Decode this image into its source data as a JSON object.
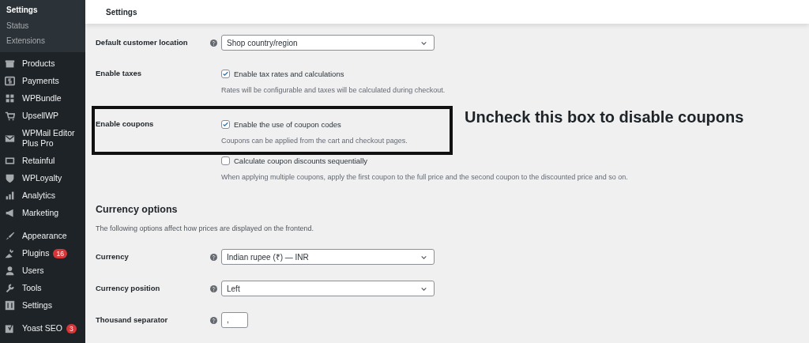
{
  "sidebar": {
    "submenu": [
      {
        "label": "Settings",
        "selected": true
      },
      {
        "label": "Status",
        "selected": false
      },
      {
        "label": "Extensions",
        "selected": false
      }
    ],
    "menu_groups": [
      {
        "items": [
          {
            "label": "Products"
          },
          {
            "label": "Payments"
          },
          {
            "label": "WPBundle"
          },
          {
            "label": "UpsellWP"
          },
          {
            "label": "WPMail Editor Plus Pro"
          },
          {
            "label": "Retainful"
          },
          {
            "label": "WPLoyalty"
          },
          {
            "label": "Analytics"
          },
          {
            "label": "Marketing"
          }
        ]
      },
      {
        "items": [
          {
            "label": "Appearance"
          },
          {
            "label": "Plugins",
            "badge": "16"
          },
          {
            "label": "Users"
          },
          {
            "label": "Tools"
          },
          {
            "label": "Settings"
          }
        ]
      },
      {
        "items": [
          {
            "label": "Yoast SEO",
            "badge": "3"
          }
        ]
      }
    ]
  },
  "header": {
    "title": "Settings"
  },
  "fields": [
    {
      "kind": "select",
      "label": "Default customer location",
      "help": true,
      "value": "Shop country/region"
    },
    {
      "kind": "checkboxes",
      "label": "Enable taxes",
      "help": false,
      "options": [
        {
          "label": "Enable tax rates and calculations",
          "checked": true,
          "description": "Rates will be configurable and taxes will be calculated during checkout."
        }
      ]
    },
    {
      "kind": "checkboxes",
      "label": "Enable coupons",
      "help": false,
      "highlighted": true,
      "options": [
        {
          "label": "Enable the use of coupon codes",
          "checked": true,
          "description": "Coupons can be applied from the cart and checkout pages."
        },
        {
          "label": "Calculate coupon discounts sequentially",
          "checked": false,
          "description": "When applying multiple coupons, apply the first coupon to the full price and the second coupon to the discounted price and so on."
        }
      ]
    },
    {
      "kind": "heading",
      "title": "Currency options",
      "description": "The following options affect how prices are displayed on the frontend."
    },
    {
      "kind": "select",
      "label": "Currency",
      "help": true,
      "value": "Indian rupee (₹) — INR"
    },
    {
      "kind": "select",
      "label": "Currency position",
      "help": true,
      "value": "Left"
    },
    {
      "kind": "text",
      "label": "Thousand separator",
      "help": true,
      "value": ","
    }
  ],
  "annotation": {
    "text": "Uncheck this box to disable coupons"
  }
}
